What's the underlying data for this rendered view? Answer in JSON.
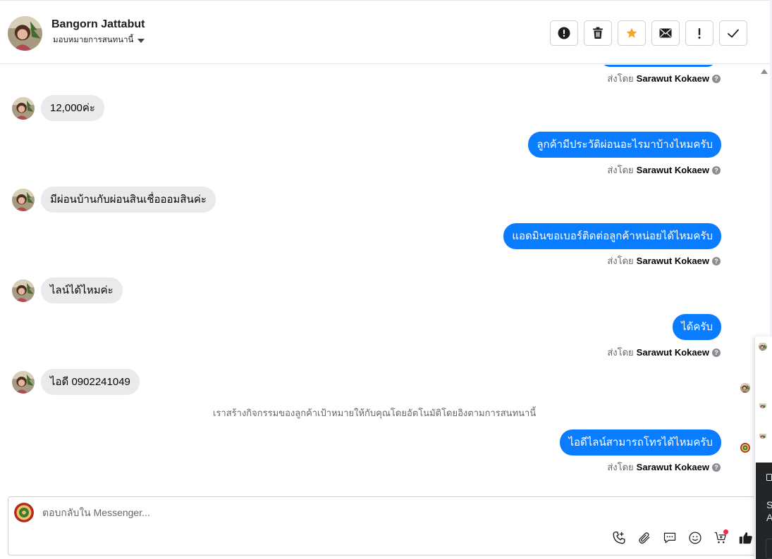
{
  "header": {
    "contact_name": "Bangorn Jattabut",
    "assign_label": "มอบหมายการสนทนานี้",
    "toolbar": [
      {
        "icon": "alert-circle-icon",
        "name": "mark-spam-button"
      },
      {
        "icon": "trash-icon",
        "name": "delete-button"
      },
      {
        "icon": "star-icon",
        "name": "star-button"
      },
      {
        "icon": "envelope-icon",
        "name": "mark-unread-button"
      },
      {
        "icon": "exclamation-icon",
        "name": "follow-up-button"
      },
      {
        "icon": "check-icon",
        "name": "mark-done-button"
      }
    ]
  },
  "thread": {
    "sent_by_prefix": "ส่งโดย",
    "agent_name": "Sarawut Kokaew",
    "messages": [
      {
        "dir": "in",
        "text": "12,000ค่ะ"
      },
      {
        "dir": "out",
        "text": "ลูกค้ามีประวัติผ่อนอะไรมาบ้างไหมครับ"
      },
      {
        "dir": "in",
        "text": "มีผ่อนบ้านกับผ่อนสินเชื่อออมสินค่ะ"
      },
      {
        "dir": "out",
        "text": "แอดมินขอเบอร์ติดต่อลูกค้าหน่อยได้ไหมครับ"
      },
      {
        "dir": "in",
        "text": "ไลน์ได้ไหมค่ะ"
      },
      {
        "dir": "out",
        "text": "ได้ครับ"
      },
      {
        "dir": "in",
        "text": "ไอดี 0902241049"
      },
      {
        "dir": "out",
        "text": "ไอดีไลน์สามารถโทรได้ไหมครับ"
      }
    ],
    "system_note": "เราสร้างกิจกรรมของลูกค้าเป้าหมายให้กับคุณโดยอัตโนมัติโดยอิงตามการสนทนานี้"
  },
  "composer": {
    "placeholder": "ตอบกลับใน Messenger..."
  },
  "side_panel": {
    "line1": "S",
    "line2": "A"
  },
  "colors": {
    "outgoing_bubble": "#0a7cff",
    "incoming_bubble": "#e9eaec",
    "star": "#f5a623"
  }
}
